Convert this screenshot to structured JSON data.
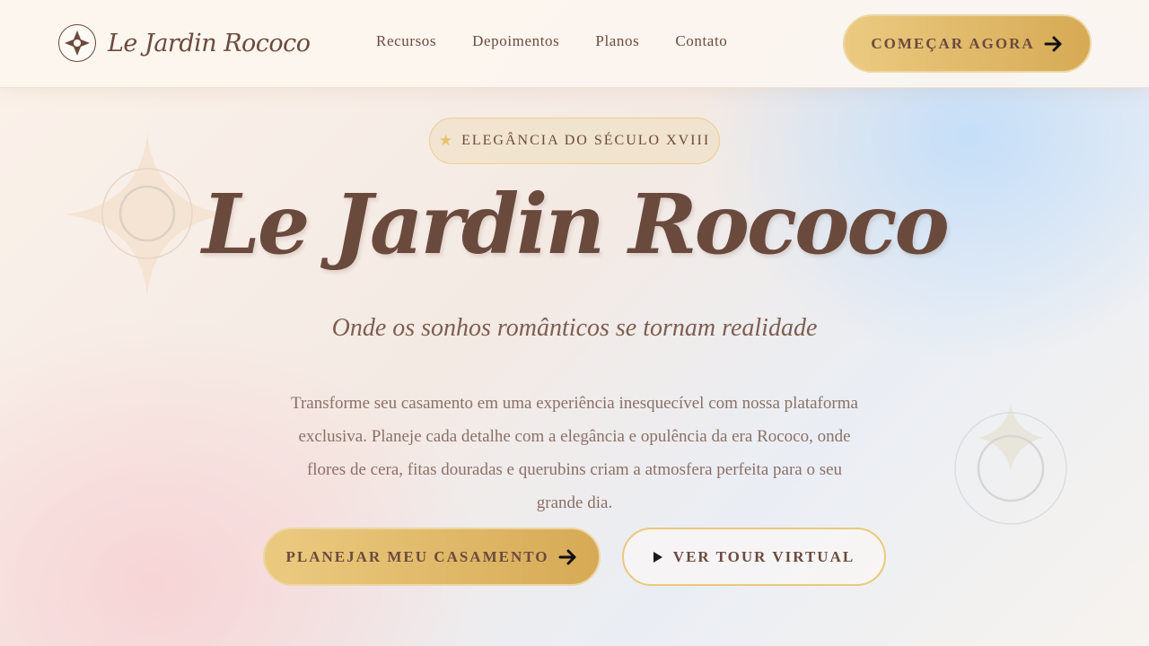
{
  "brand": {
    "name": "Le Jardin Rococo",
    "emblem_icon": "compass-star-icon"
  },
  "nav": {
    "items": [
      {
        "label": "Recursos"
      },
      {
        "label": "Depoimentos"
      },
      {
        "label": "Planos"
      },
      {
        "label": "Contato"
      }
    ]
  },
  "header_cta": {
    "label": "COMEÇAR AGORA",
    "icon": "arrow-right-icon"
  },
  "hero": {
    "badge": {
      "icon": "star-icon",
      "label": "ELEGÂNCIA DO SÉCULO XVIII"
    },
    "title": "Le Jardin Rococo",
    "subtitle": "Onde os sonhos românticos se tornam realidade",
    "description": "Transforme seu casamento em uma experiência inesquecível com nossa plataforma exclusiva. Planeje cada detalhe com a elegância e opulência da era Rococo, onde flores de cera, fitas douradas e querubins criam a atmosfera perfeita para o seu grande dia.",
    "primary_button": {
      "label": "PLANEJAR MEU CASAMENTO",
      "icon": "arrow-right-icon"
    },
    "secondary_button": {
      "label": "VER TOUR VIRTUAL",
      "icon": "play-icon"
    }
  },
  "colors": {
    "primary_text": "#6b4a3e",
    "gold_start": "#ebca80",
    "gold_end": "#d6aa55",
    "gold_border": "#e9c97d"
  }
}
